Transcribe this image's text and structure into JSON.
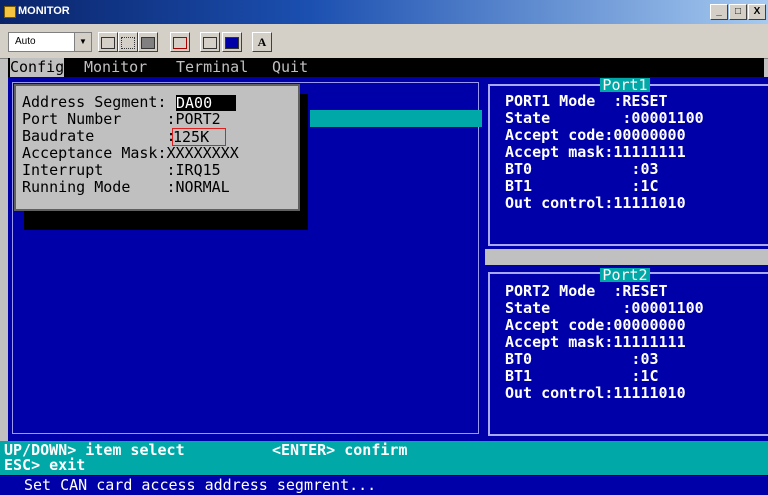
{
  "window": {
    "title": "MONITOR",
    "buttons": [
      "_",
      "□",
      "X"
    ]
  },
  "toolbar": {
    "font_value": "Auto",
    "buttons": [
      "copy-icon",
      "select-icon",
      "paste-icon",
      "fullscreen-icon",
      "properties-icon",
      "background-icon"
    ],
    "font_button": "A"
  },
  "menu": [
    "Config",
    "Monitor",
    "Terminal",
    "Quit"
  ],
  "config_dialog": {
    "lines": "Address Segment:\nPort Number     :PORT2\nBaudrate        :\nAcceptance Mask:XXXXXXXX\nInterrupt       :IRQ15\nRunning Mode    :NORMAL",
    "address_value": "DA00",
    "baudrate_value": "125K"
  },
  "port1": {
    "title": "Port1",
    "lines": "PORT1 Mode  :RESET\nState        :00001100\nAccept code:00000000\nAccept mask:11111111\nBT0           :03\nBT1           :1C\nOut control:11111010"
  },
  "port2": {
    "title": "Port2",
    "lines": "PORT2 Mode  :RESET\nState        :00001100\nAccept code:00000000\nAccept mask:11111111\nBT0           :03\nBT1           :1C\nOut control:11111010"
  },
  "status": {
    "line1": "UP/DOWN> item select",
    "line2": "ESC> exit",
    "confirm": "<ENTER> confirm",
    "help": "Set CAN card access address segmrent..."
  }
}
